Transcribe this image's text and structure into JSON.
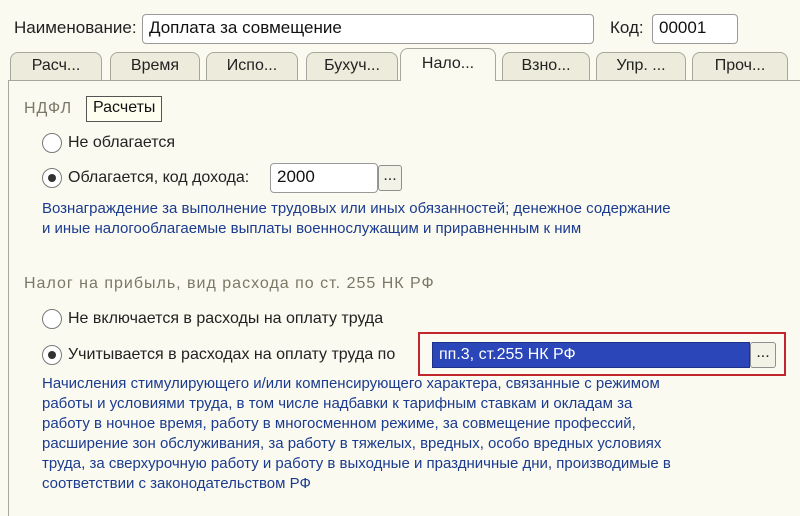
{
  "header": {
    "name_label": "Наименование:",
    "name_value": "Доплата за совмещение",
    "code_label": "Код:",
    "code_value": "00001"
  },
  "tabs": [
    {
      "label": "Расч..."
    },
    {
      "label": "Время"
    },
    {
      "label": "Испо..."
    },
    {
      "label": "Бухуч..."
    },
    {
      "label": "Нало...",
      "active": true
    },
    {
      "label": "Взно..."
    },
    {
      "label": "Упр. ..."
    },
    {
      "label": "Проч..."
    }
  ],
  "ndfl": {
    "title": "НДФЛ",
    "tooltip": "Расчеты",
    "option1": "Не облагается",
    "option2": "Облагается, код дохода:",
    "income_code": "2000",
    "ellipsis": "...",
    "description_line1": "Вознаграждение за выполнение трудовых или иных обязанностей; денежное содержание",
    "description_line2": "и иные налогооблагаемые выплаты военнослужащим и приравненным к ним"
  },
  "profit_tax": {
    "title": "Налог на прибыль, вид расхода по ст. 255 НК РФ",
    "option1": "Не включается в расходы на оплату труда",
    "option2": "Учитывается в расходах на оплату труда по",
    "selected_value": "пп.3, ст.255 НК РФ",
    "ellipsis": "...",
    "description_lines": [
      "Начисления стимулирующего и/или компенсирующего характера, связанные с режимом",
      "работы и условиями труда, в том числе надбавки к тарифным ставкам и окладам за",
      "работу в ночное время, работу в многосменном режиме, за совмещение профессий,",
      "расширение зон обслуживания, за работу в тяжелых, вредных, особо вредных условиях",
      "труда, за сверхурочную работу и работу в выходные и праздничные дни, производимые в",
      "соответствии с законодательством РФ"
    ]
  },
  "colors": {
    "background": "#fbfaf0",
    "description_text": "#1b3b8f",
    "selection": "#2a46b8",
    "highlight_frame": "#c0262c"
  }
}
